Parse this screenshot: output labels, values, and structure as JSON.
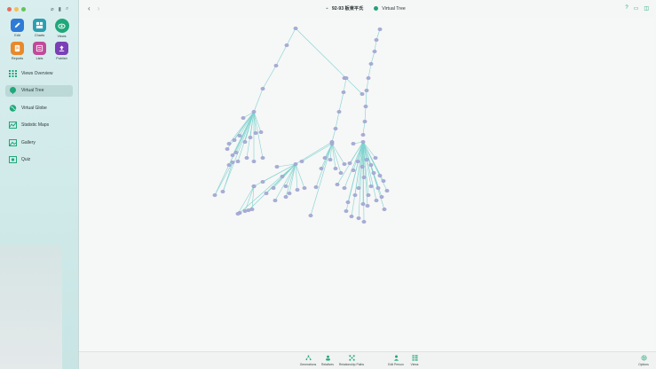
{
  "window": {
    "title": "92-93 板東平氏",
    "view_title": "Virtual Tree"
  },
  "sidebar": {
    "apps": [
      {
        "label": "Edit",
        "icon": "pencil-icon",
        "color": "#2f7bd6"
      },
      {
        "label": "Charts",
        "icon": "charts-icon",
        "color": "#2a9fb0"
      },
      {
        "label": "Views",
        "icon": "eye-icon",
        "color": "#1fa87a"
      },
      {
        "label": "Reports",
        "icon": "reports-icon",
        "color": "#e8892b"
      },
      {
        "label": "Lists",
        "icon": "lists-icon",
        "color": "#c24a9a"
      },
      {
        "label": "Publish",
        "icon": "publish-icon",
        "color": "#7b3fb8"
      }
    ],
    "nav": [
      {
        "label": "Views Overview",
        "icon": "grid-icon"
      },
      {
        "label": "Virtual Tree",
        "icon": "tree-icon",
        "active": true
      },
      {
        "label": "Virtual Globe",
        "icon": "globe-icon"
      },
      {
        "label": "Statistic Maps",
        "icon": "map-icon"
      },
      {
        "label": "Gallery",
        "icon": "gallery-icon"
      },
      {
        "label": "Quiz",
        "icon": "quiz-icon"
      }
    ]
  },
  "toolbar": {
    "back_icon": "chevron-left-icon",
    "forward_icon": "chevron-right-icon",
    "right_icons": [
      "help-icon",
      "window-icon",
      "sidebar-icon"
    ]
  },
  "bottom_bar": [
    {
      "label": "Generations",
      "icon": "generations-icon"
    },
    {
      "label": "Relatives",
      "icon": "relatives-icon"
    },
    {
      "label": "Relationship Paths",
      "icon": "relationship-paths-icon"
    },
    {
      "label": "Edit Person",
      "icon": "person-icon"
    },
    {
      "label": "Views",
      "icon": "views-icon"
    },
    {
      "label": "Options",
      "icon": "options-gear-icon"
    }
  ],
  "colors": {
    "accent": "#1fa87a",
    "edge": "#7fd3cf",
    "node": "#a8acd6"
  }
}
